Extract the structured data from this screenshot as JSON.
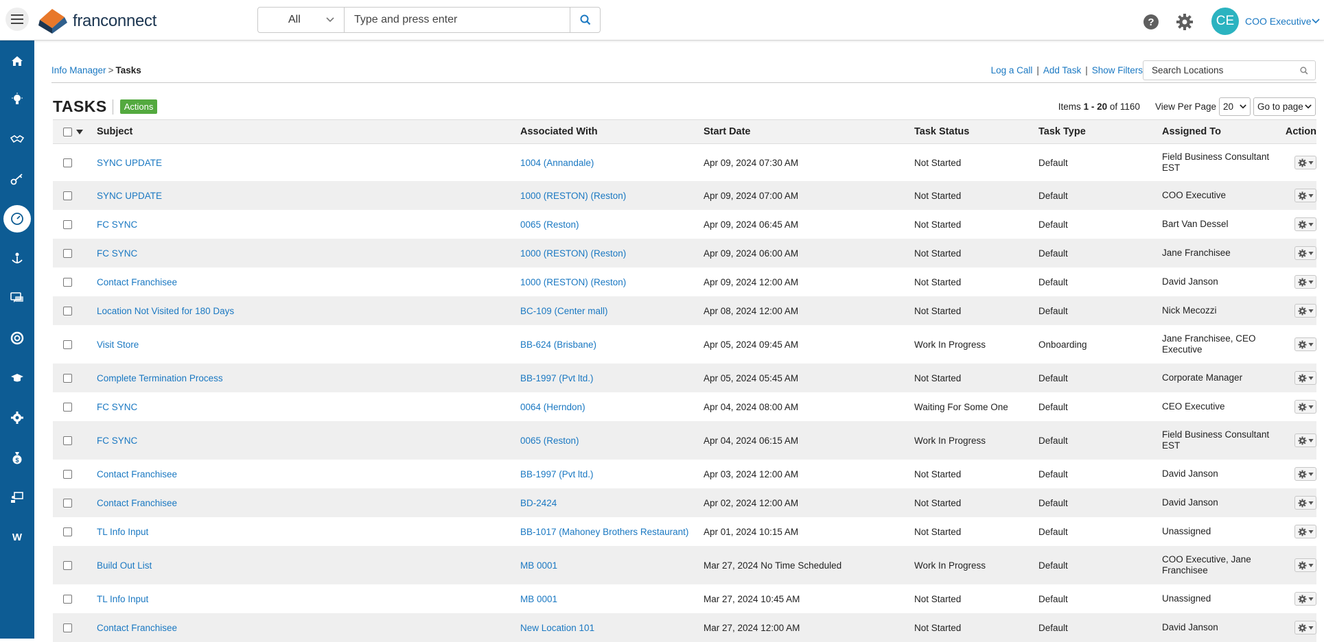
{
  "header": {
    "logo_text": "franconnect",
    "search_scope": "All",
    "search_placeholder": "Type and press enter",
    "user_initials": "CE",
    "user_name": "COO Executive",
    "colors": {
      "brand_blue": "#0d5c94",
      "avatar": "#2bb3c0",
      "link": "#1a78c2",
      "actions_green": "#53a93f"
    }
  },
  "sidebar": {
    "items": [
      {
        "icon": "home-icon"
      },
      {
        "icon": "lightbulb-icon"
      },
      {
        "icon": "handshake-icon"
      },
      {
        "icon": "key-icon"
      },
      {
        "icon": "dashboard-gauge-icon",
        "active": true
      },
      {
        "icon": "anchor-person-icon"
      },
      {
        "icon": "chat-icon"
      },
      {
        "icon": "lifebuoy-icon"
      },
      {
        "icon": "graduation-cap-icon"
      },
      {
        "icon": "settings-icon"
      },
      {
        "icon": "money-bag-icon"
      },
      {
        "icon": "presentation-icon"
      },
      {
        "icon": "w-letter-icon",
        "label": "W"
      }
    ]
  },
  "breadcrumb": {
    "parent": "Info Manager",
    "separator": ">",
    "current": "Tasks"
  },
  "links": {
    "log_call": "Log a Call",
    "add_task": "Add Task",
    "show_filters": "Show Filters",
    "sep": "|"
  },
  "location_search": {
    "placeholder": "Search Locations"
  },
  "page": {
    "title": "TASKS",
    "actions": "Actions"
  },
  "pager": {
    "items_label": "Items",
    "range": "1 - 20",
    "of": "of",
    "total": "1160",
    "view_per_page_label": "View Per Page",
    "per_page": "20",
    "go_to_page": "Go to page"
  },
  "table": {
    "columns": [
      "Subject",
      "Associated With",
      "Start Date",
      "Task Status",
      "Task Type",
      "Assigned To",
      "Action"
    ],
    "rows": [
      {
        "subject": "SYNC UPDATE",
        "assoc": "1004 (Annandale)",
        "date": "Apr 09, 2024 07:30 AM",
        "status": "Not Started",
        "type": "Default",
        "assigned": "Field Business Consultant EST"
      },
      {
        "subject": "SYNC UPDATE",
        "assoc": "1000 (RESTON) (Reston)",
        "date": "Apr 09, 2024 07:00 AM",
        "status": "Not Started",
        "type": "Default",
        "assigned": "COO Executive"
      },
      {
        "subject": "FC SYNC",
        "assoc": "0065 (Reston)",
        "date": "Apr 09, 2024 06:45 AM",
        "status": "Not Started",
        "type": "Default",
        "assigned": "Bart Van Dessel"
      },
      {
        "subject": "FC SYNC",
        "assoc": "1000 (RESTON) (Reston)",
        "date": "Apr 09, 2024 06:00 AM",
        "status": "Not Started",
        "type": "Default",
        "assigned": "Jane Franchisee"
      },
      {
        "subject": "Contact Franchisee",
        "assoc": "1000 (RESTON) (Reston)",
        "date": "Apr 09, 2024 12:00 AM",
        "status": "Not Started",
        "type": "Default",
        "assigned": "David Janson"
      },
      {
        "subject": "Location Not Visited for 180 Days",
        "assoc": "BC-109 (Center mall)",
        "date": "Apr 08, 2024 12:00 AM",
        "status": "Not Started",
        "type": "Default",
        "assigned": "Nick Mecozzi"
      },
      {
        "subject": "Visit Store",
        "assoc": "BB-624 (Brisbane)",
        "date": "Apr 05, 2024 09:45 AM",
        "status": "Work In Progress",
        "type": "Onboarding",
        "assigned": "Jane Franchisee, CEO Executive"
      },
      {
        "subject": "Complete Termination Process",
        "assoc": "BB-1997 (Pvt ltd.)",
        "date": "Apr 05, 2024 05:45 AM",
        "status": "Not Started",
        "type": "Default",
        "assigned": "Corporate Manager"
      },
      {
        "subject": "FC SYNC",
        "assoc": "0064 (Herndon)",
        "date": "Apr 04, 2024 08:00 AM",
        "status": "Waiting For Some One",
        "type": "Default",
        "assigned": "CEO Executive"
      },
      {
        "subject": "FC SYNC",
        "assoc": "0065 (Reston)",
        "date": "Apr 04, 2024 06:15 AM",
        "status": "Work In Progress",
        "type": "Default",
        "assigned": "Field Business Consultant EST"
      },
      {
        "subject": "Contact Franchisee",
        "assoc": "BB-1997 (Pvt ltd.)",
        "date": "Apr 03, 2024 12:00 AM",
        "status": "Not Started",
        "type": "Default",
        "assigned": "David Janson"
      },
      {
        "subject": "Contact Franchisee",
        "assoc": "BD-2424",
        "date": "Apr 02, 2024 12:00 AM",
        "status": "Not Started",
        "type": "Default",
        "assigned": "David Janson"
      },
      {
        "subject": "TL Info Input",
        "assoc": "BB-1017 (Mahoney Brothers Restaurant)",
        "date": "Apr 01, 2024 10:15 AM",
        "status": "Not Started",
        "type": "Default",
        "assigned": "Unassigned"
      },
      {
        "subject": "Build Out List",
        "assoc": "MB 0001",
        "date": "Mar 27, 2024 No Time Scheduled",
        "status": "Work In Progress",
        "type": "Default",
        "assigned": "COO Executive, Jane Franchisee"
      },
      {
        "subject": "TL Info Input",
        "assoc": "MB 0001",
        "date": "Mar 27, 2024 10:45 AM",
        "status": "Not Started",
        "type": "Default",
        "assigned": "Unassigned"
      },
      {
        "subject": "Contact Franchisee",
        "assoc": "New Location 101",
        "date": "Mar 27, 2024 12:00 AM",
        "status": "Not Started",
        "type": "Default",
        "assigned": "David Janson"
      }
    ]
  }
}
